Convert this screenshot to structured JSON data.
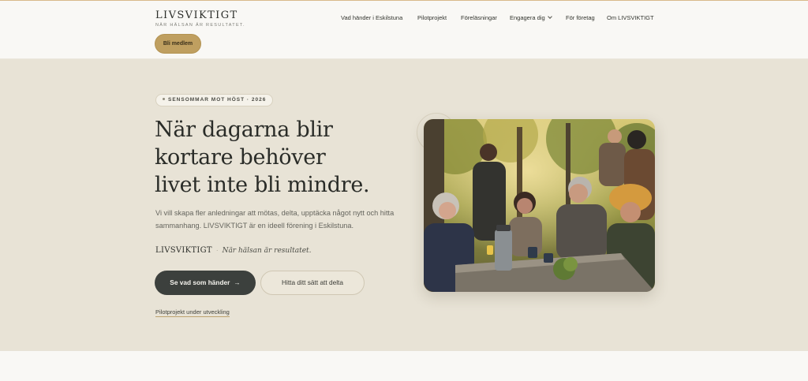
{
  "header": {
    "logo": "LIVSVIKTIGT",
    "tagline": "NÄR HÄLSAN ÄR RESULTATET.",
    "member_button": "Bli medlem",
    "nav": [
      {
        "label": "Vad händer i Eskilstuna"
      },
      {
        "label": "Pilotprojekt"
      },
      {
        "label": "Föreläsningar"
      },
      {
        "label": "Engagera dig"
      },
      {
        "label": "För företag"
      },
      {
        "label": "Om LIVSVIKTIGT"
      }
    ]
  },
  "hero": {
    "pill": "SENSOMMAR MOT HÖST · 2026",
    "heading_line1": "När dagarna blir",
    "heading_line2": "kortare behöver",
    "heading_line3": "livet inte bli mindre.",
    "lead": "Vi vill skapa fler anledningar att mötas, delta, upptäcka något nytt och hitta sammanhang. LIVSVIKTIGT är en ideell förening i Eskilstuna.",
    "signature_name": "LIVSVIKTIGT",
    "signature_sep": "·",
    "signature_tagline": "När hälsan är resultatet.",
    "primary_button": "Se vad som händer",
    "primary_arrow": "→",
    "secondary_button": "Hitta ditt sätt att delta",
    "pilot_link": "Pilotprojekt under utveckling"
  },
  "colors": {
    "accent_gold": "#bf9f60",
    "hero_bg": "#e8e3d6",
    "dark_button": "#3c403d",
    "page_bg": "#f9f8f5"
  },
  "icons": {
    "nav_dropdown": "chevron-down-icon",
    "button_arrow": "arrow-right-icon"
  }
}
